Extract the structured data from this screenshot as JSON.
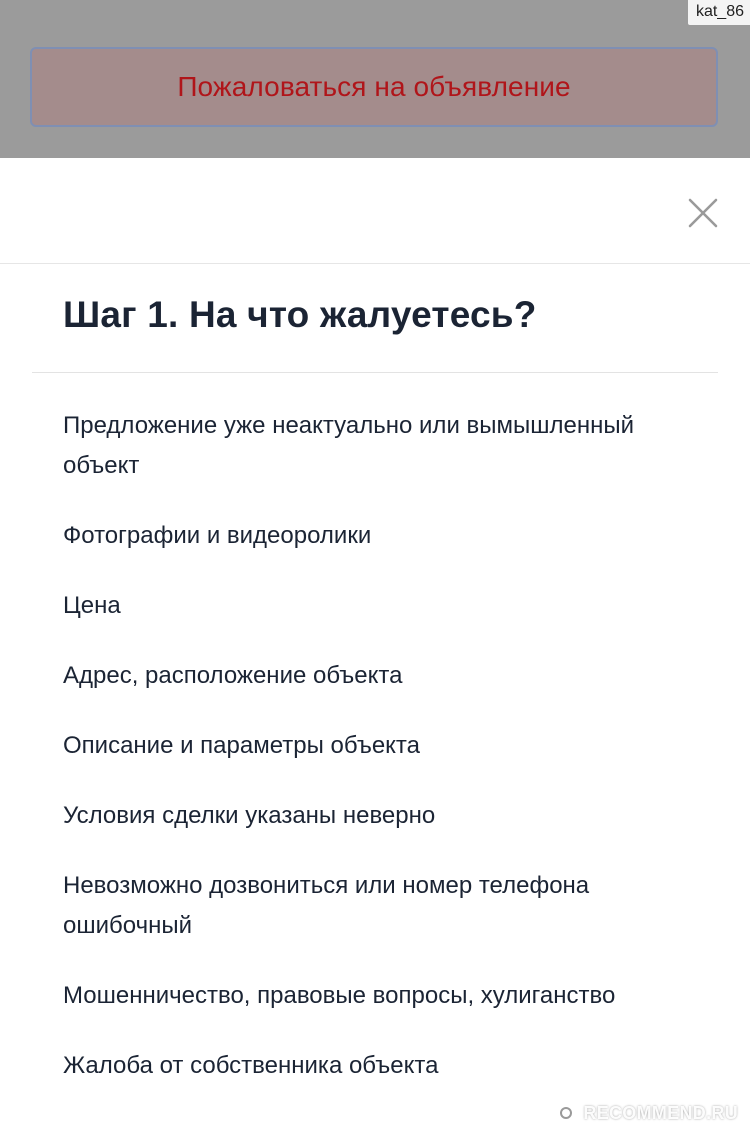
{
  "header": {
    "report_button_label": "Пожаловаться на объявление",
    "user_tag": "kat_86"
  },
  "sheet": {
    "title": "Шаг 1. На что жалуетесь?",
    "close_icon": "close-icon",
    "options": [
      "Предложение уже неактуально или вымышленный объект",
      "Фотографии и видеоролики",
      "Цена",
      "Адрес, расположение объекта",
      "Описание и параметры объекта",
      "Условия сделки указаны неверно",
      "Невозможно дозвониться или номер телефона ошибочный",
      "Мошенничество, правовые вопросы, хулиганство",
      "Жалоба от собственника объекта"
    ]
  },
  "watermark": {
    "text": "RECOMMEND.RU"
  },
  "colors": {
    "backdrop": "#9b9b9b",
    "report_text": "#b0151a",
    "text_primary": "#1b2434"
  }
}
